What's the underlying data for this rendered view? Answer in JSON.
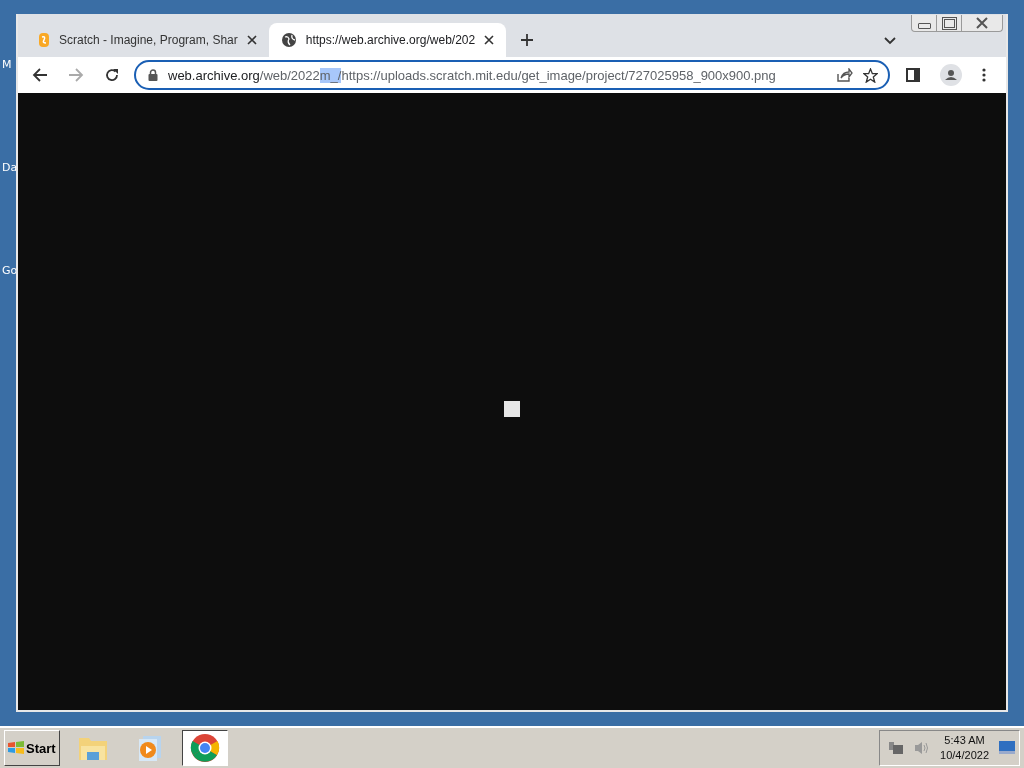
{
  "desktop": {
    "icons": [
      {
        "label": "M"
      },
      {
        "label": "Da"
      },
      {
        "label": "Go"
      }
    ]
  },
  "browser": {
    "tabs": [
      {
        "title": "Scratch - Imagine, Program, Shar",
        "kind": "scratch",
        "selected": false
      },
      {
        "title": "https://web.archive.org/web/202",
        "kind": "globe",
        "selected": true
      }
    ],
    "address_bar": {
      "host": "web.archive.org",
      "path": "/web/2022",
      "selected_text": "m_/",
      "rest": "https://uploads.scratch.mit.edu/get_image/project/727025958_900x900.png"
    }
  },
  "taskbar": {
    "start": "Start",
    "apps": [
      {
        "kind": "folder",
        "selected": false
      },
      {
        "kind": "media",
        "selected": false
      },
      {
        "kind": "chrome",
        "selected": true
      }
    ],
    "clock": {
      "time": "5:43 AM",
      "date": "10/4/2022"
    }
  }
}
